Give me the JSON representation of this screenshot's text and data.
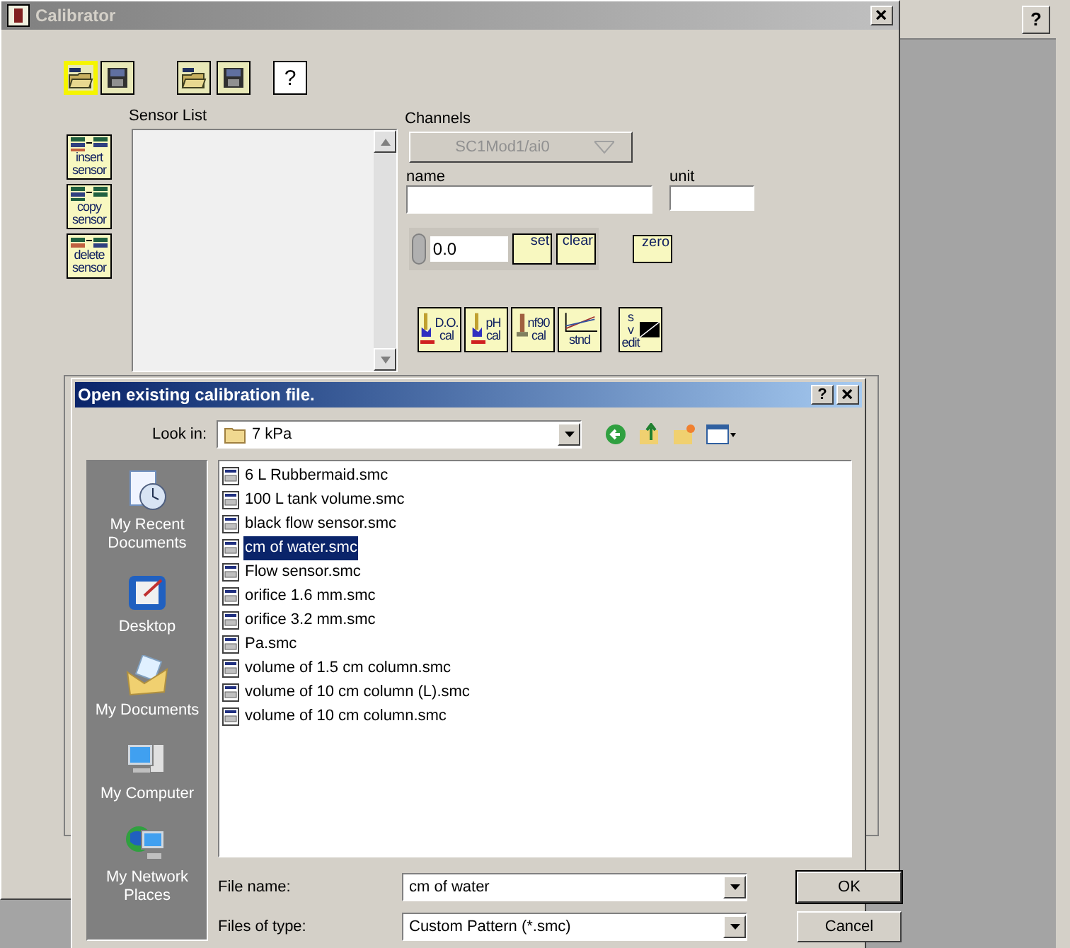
{
  "background_window": {
    "help": "?"
  },
  "calibrator": {
    "title": "Calibrator",
    "toolbar": [
      {
        "kind": "open",
        "focused": true
      },
      {
        "kind": "save",
        "focused": false
      },
      {
        "kind": "open",
        "focused": false
      },
      {
        "kind": "save",
        "focused": false
      },
      {
        "kind": "help",
        "label": "?",
        "focused": false
      }
    ],
    "sensor_buttons": [
      {
        "kind": "insert",
        "lines": [
          "insert",
          "sensor"
        ]
      },
      {
        "kind": "copy",
        "lines": [
          "copy",
          "sensor"
        ]
      },
      {
        "kind": "delete",
        "lines": [
          "delete",
          "sensor"
        ]
      }
    ],
    "sensor_list": {
      "label": "Sensor List"
    },
    "channels": {
      "label": "Channels",
      "value": "SC1Mod1/ai0",
      "disabled": true
    },
    "name": {
      "label": "name"
    },
    "unit": {
      "label": "unit"
    },
    "numeric": {
      "value": "0.0"
    },
    "point_buttons": [
      {
        "label": "set"
      },
      {
        "label": "clear"
      }
    ],
    "zero_button": {
      "label": "zero"
    },
    "cal_buttons": [
      {
        "kind": "probe",
        "lines": [
          "D.O.",
          "cal"
        ]
      },
      {
        "kind": "probe",
        "lines": [
          "pH",
          "cal"
        ]
      },
      {
        "kind": "scale",
        "lines": [
          "nf90",
          "cal"
        ]
      },
      {
        "kind": "graph",
        "lines": [
          "stnd"
        ]
      },
      {
        "kind": "edit",
        "lines": [
          "s",
          "v",
          "edit"
        ]
      }
    ]
  },
  "dialog": {
    "title": "Open existing calibration file.",
    "help": "?",
    "look_in": {
      "label": "Look in:",
      "value": "7 kPa"
    },
    "places": [
      {
        "kind": "recent",
        "label": "My Recent Documents"
      },
      {
        "kind": "desktop",
        "label": "Desktop"
      },
      {
        "kind": "documents",
        "label": "My Documents"
      },
      {
        "kind": "computer",
        "label": "My Computer"
      },
      {
        "kind": "network",
        "label": "My Network Places"
      }
    ],
    "files": [
      {
        "name": "6 L Rubbermaid.smc",
        "selected": false
      },
      {
        "name": "100 L tank volume.smc",
        "selected": false
      },
      {
        "name": "black flow sensor.smc",
        "selected": false
      },
      {
        "name": "cm of water.smc",
        "selected": true
      },
      {
        "name": "Flow sensor.smc",
        "selected": false
      },
      {
        "name": "orifice 1.6 mm.smc",
        "selected": false
      },
      {
        "name": "orifice 3.2 mm.smc",
        "selected": false
      },
      {
        "name": "Pa.smc",
        "selected": false
      },
      {
        "name": "volume of 1.5 cm column.smc",
        "selected": false
      },
      {
        "name": "volume of 10 cm column (L).smc",
        "selected": false
      },
      {
        "name": "volume of 10 cm column.smc",
        "selected": false
      }
    ],
    "file_name": {
      "label": "File name:",
      "value": "cm of water"
    },
    "file_type": {
      "label": "Files of type:",
      "value": "Custom Pattern (*.smc)"
    },
    "buttons": [
      "OK",
      "Cancel"
    ]
  }
}
